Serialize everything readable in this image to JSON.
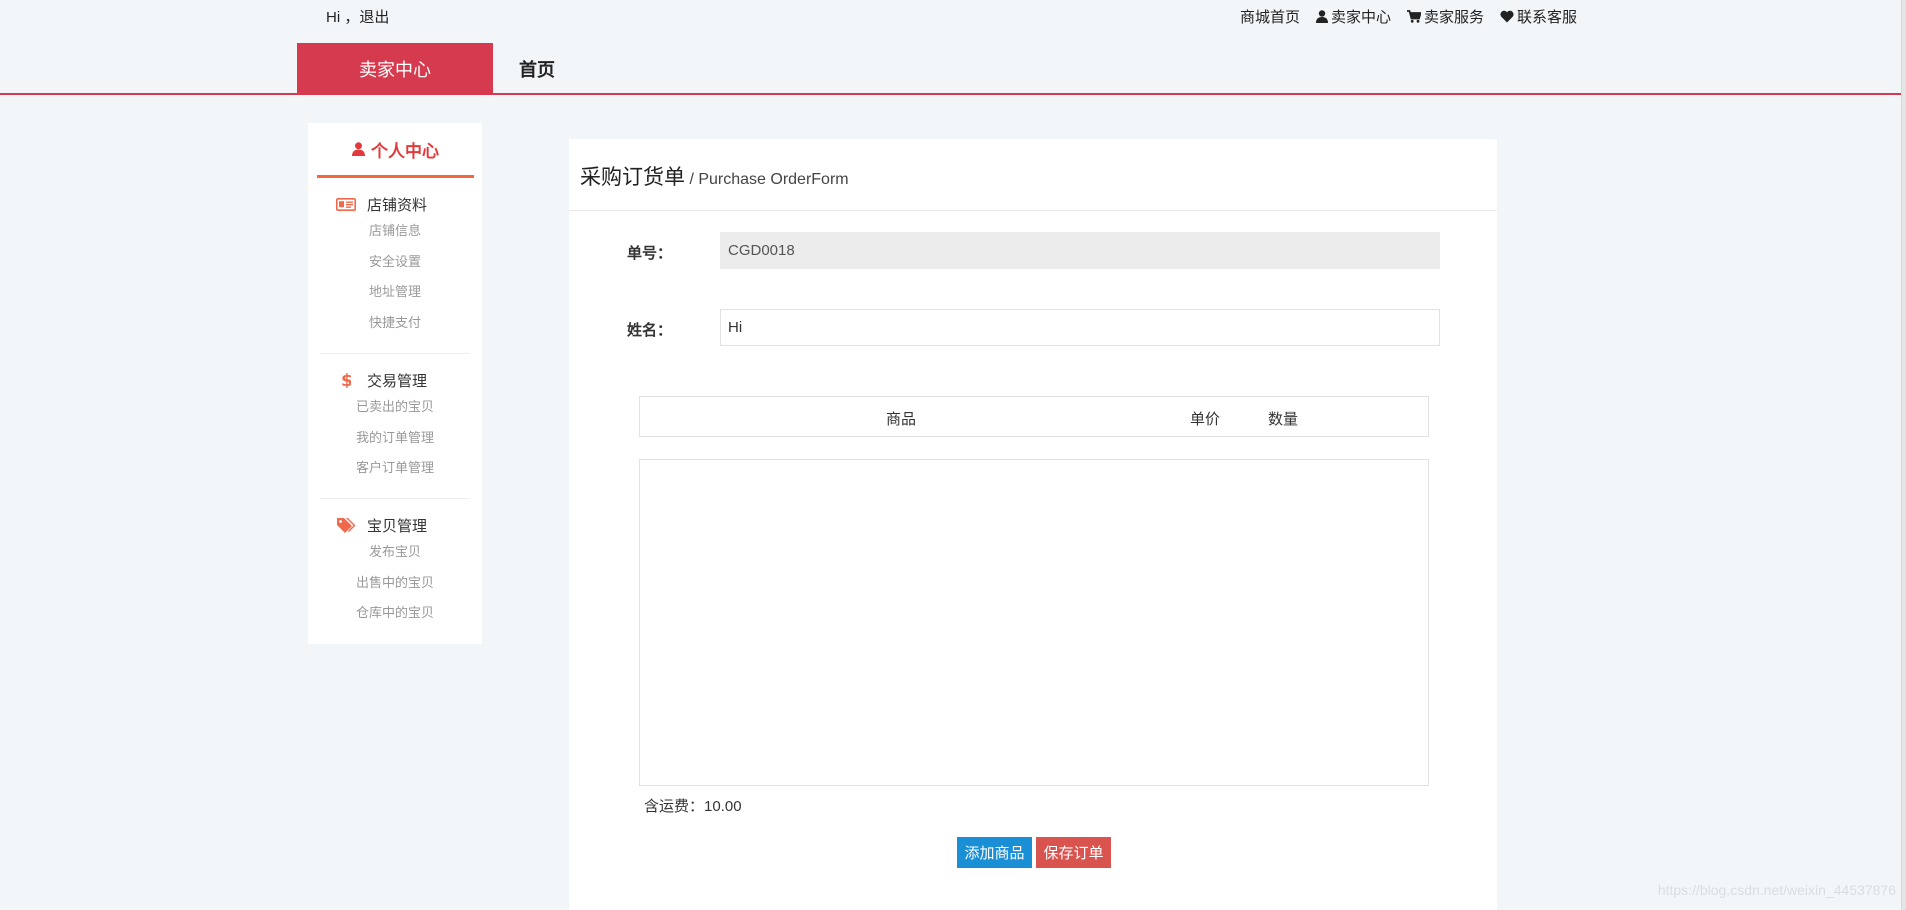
{
  "topbar": {
    "greeting": "Hi ，",
    "logout": "退出",
    "links": [
      {
        "label": "商城首页",
        "icon": ""
      },
      {
        "label": "卖家中心",
        "icon": "user-icon"
      },
      {
        "label": "卖家服务",
        "icon": "cart-icon"
      },
      {
        "label": "联系客服",
        "icon": "heart-icon"
      }
    ]
  },
  "nav": {
    "active": "卖家中心",
    "home": "首页",
    "accent": "#d53a4e"
  },
  "sidebar": {
    "title": "个人中心",
    "title_icon": "user-icon",
    "groups": [
      {
        "title": "店铺资料",
        "icon": "id-card-icon",
        "items": [
          "店铺信息",
          "安全设置",
          "地址管理",
          "快捷支付"
        ]
      },
      {
        "title": "交易管理",
        "icon": "dollar-icon",
        "items": [
          "已卖出的宝贝",
          "我的订单管理",
          "客户订单管理"
        ]
      },
      {
        "title": "宝贝管理",
        "icon": "tags-icon",
        "items": [
          "发布宝贝",
          "出售中的宝贝",
          "仓库中的宝贝"
        ]
      }
    ]
  },
  "main": {
    "title": "采购订货单",
    "subtitle": " / Purchase  OrderForm",
    "fields": {
      "order_no_label": "单号：",
      "order_no_value": "CGD0018",
      "name_label": "姓名：",
      "name_value": "Hi"
    },
    "table": {
      "columns": [
        "商品",
        "单价",
        "数量"
      ]
    },
    "shipping": "含运费：10.00",
    "buttons": {
      "add": "添加商品",
      "save": "保存订单"
    }
  },
  "watermark": "https://blog.csdn.net/weixin_44537876"
}
